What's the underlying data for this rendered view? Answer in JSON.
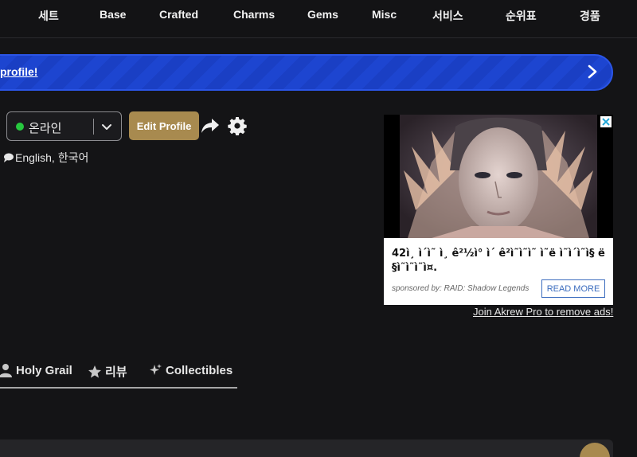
{
  "nav": {
    "items": [
      {
        "label": "세트"
      },
      {
        "label": "Base"
      },
      {
        "label": "Crafted"
      },
      {
        "label": "Charms"
      },
      {
        "label": "Gems"
      },
      {
        "label": "Misc"
      },
      {
        "label": "서비스"
      },
      {
        "label": "순위표"
      },
      {
        "label": "경품"
      }
    ]
  },
  "banner": {
    "text": "profile!",
    "icon": "chevron-right-icon"
  },
  "profile": {
    "status_label": "온라인",
    "status_color": "#27c93f",
    "edit_label": "Edit Profile",
    "languages": "English, 한국어"
  },
  "ad": {
    "headline": "42ì¸ ì´ì˜ ì¸ ê²½ì° ì´ ê²ì˜ì˜ì˜ ì˜ë ì˜ì´ì˜ì§ ë§ì˜ì˜ì˜ì¤.",
    "sponsor": "sponsored by: RAID: Shadow Legends",
    "read_more": "READ MORE",
    "remove_ads": "Join Akrew Pro to remove ads!"
  },
  "tabs": [
    {
      "label": "Holy Grail",
      "icon": "person-icon"
    },
    {
      "label": "리뷰",
      "icon": "star-icon"
    },
    {
      "label": "Collectibles",
      "icon": "sparkle-icon"
    }
  ],
  "colors": {
    "accent": "#a88a4f",
    "banner": "#1a3fc4",
    "background": "#141416"
  }
}
